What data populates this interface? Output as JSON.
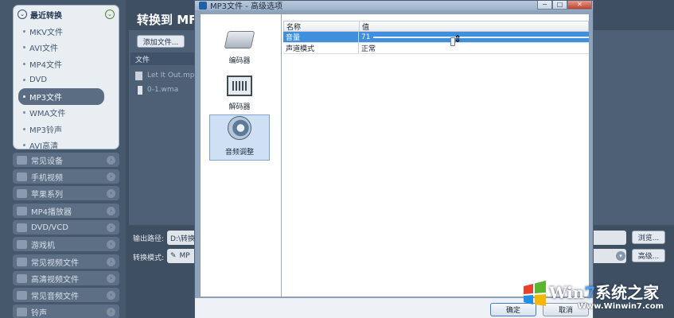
{
  "sidebar": {
    "open_group": {
      "label": "最近转换",
      "items": [
        {
          "label": "MKV文件"
        },
        {
          "label": "AVI文件"
        },
        {
          "label": "MP4文件"
        },
        {
          "label": "DVD"
        },
        {
          "label": "MP3文件",
          "selected": true
        },
        {
          "label": "WMA文件"
        },
        {
          "label": "MP3铃声"
        },
        {
          "label": "AVI高清"
        }
      ]
    },
    "categories": [
      {
        "label": "常见设备"
      },
      {
        "label": "手机视频"
      },
      {
        "label": "苹果系列"
      },
      {
        "label": "MP4播放器"
      },
      {
        "label": "DVD/VCD"
      },
      {
        "label": "游戏机"
      },
      {
        "label": "常见视频文件"
      },
      {
        "label": "高清视频文件"
      },
      {
        "label": "常见音频文件"
      },
      {
        "label": "铃声"
      }
    ]
  },
  "main": {
    "title": "转换到 MF",
    "add_file_label": "添加文件...",
    "file_column": "文件",
    "files": [
      {
        "name": "Let It Out.mp"
      },
      {
        "name": "0-1.wma"
      }
    ],
    "output_path_label": "输出路径:",
    "output_path_value": "D:\\转换",
    "browse_label": "浏览...",
    "convert_mode_label": "转换模式:",
    "convert_mode_value": "MP",
    "advanced_label": "高级..."
  },
  "dialog": {
    "title": "MP3文件 - 高级选项",
    "nav": [
      {
        "label": "编码器",
        "icon": "drive-icon"
      },
      {
        "label": "解码器",
        "icon": "chip-icon"
      },
      {
        "label": "音频调整",
        "icon": "speaker-icon",
        "active": true
      }
    ],
    "grid": {
      "col_name": "名称",
      "col_value": "值",
      "rows": [
        {
          "name": "音量",
          "value": "71",
          "selected": true,
          "slider_fraction": 0.37
        },
        {
          "name": "声道模式",
          "value": "正常"
        }
      ]
    },
    "ok_label": "确定",
    "cancel_label": "取消",
    "window_buttons": {
      "minimize": "−",
      "maximize": "□",
      "close": "✕"
    }
  },
  "watermark": {
    "brand_prefix": "Win",
    "brand_digit": "7",
    "brand_suffix": "系统之家",
    "url": "Www.Winwin7.com"
  }
}
